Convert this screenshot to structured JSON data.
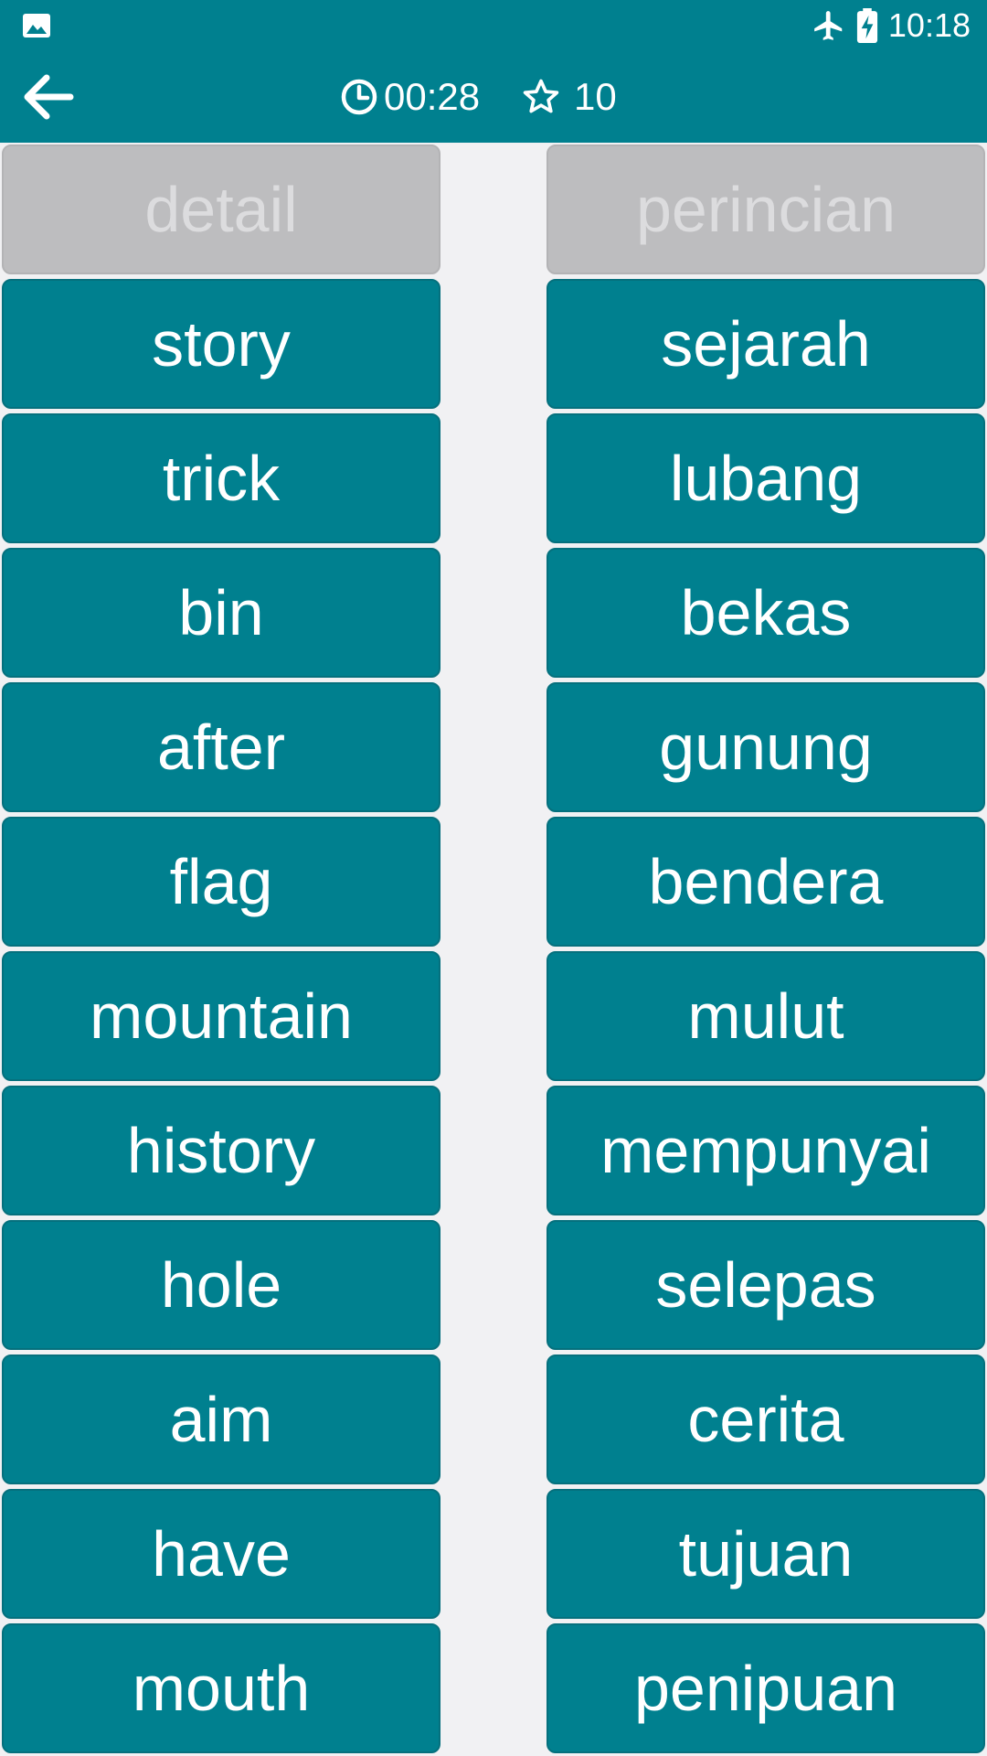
{
  "status_bar": {
    "time": "10:18",
    "icons": [
      "gallery-icon",
      "airplane-mode-icon",
      "battery-charging-icon"
    ]
  },
  "toolbar": {
    "back_icon": "arrow-left-icon",
    "timer": "00:28",
    "timer_icon": "clock-icon",
    "score": "10",
    "score_icon": "star-outline-icon"
  },
  "colors": {
    "primary": "#00808f",
    "done_tile": "#bdbdbf",
    "background": "#f1f1f3"
  },
  "left_words": [
    {
      "text": "detail",
      "state": "matched"
    },
    {
      "text": "story",
      "state": "active"
    },
    {
      "text": "trick",
      "state": "active"
    },
    {
      "text": "bin",
      "state": "active"
    },
    {
      "text": "after",
      "state": "active"
    },
    {
      "text": "flag",
      "state": "active"
    },
    {
      "text": "mountain",
      "state": "active"
    },
    {
      "text": "history",
      "state": "active"
    },
    {
      "text": "hole",
      "state": "active"
    },
    {
      "text": "aim",
      "state": "active"
    },
    {
      "text": "have",
      "state": "active"
    },
    {
      "text": "mouth",
      "state": "active"
    }
  ],
  "right_words": [
    {
      "text": "perincian",
      "state": "matched"
    },
    {
      "text": "sejarah",
      "state": "active"
    },
    {
      "text": "lubang",
      "state": "active"
    },
    {
      "text": "bekas",
      "state": "active"
    },
    {
      "text": "gunung",
      "state": "active"
    },
    {
      "text": "bendera",
      "state": "active"
    },
    {
      "text": "mulut",
      "state": "active"
    },
    {
      "text": "mempunyai",
      "state": "active"
    },
    {
      "text": "selepas",
      "state": "active"
    },
    {
      "text": "cerita",
      "state": "active"
    },
    {
      "text": "tujuan",
      "state": "active"
    },
    {
      "text": "penipuan",
      "state": "active"
    }
  ]
}
